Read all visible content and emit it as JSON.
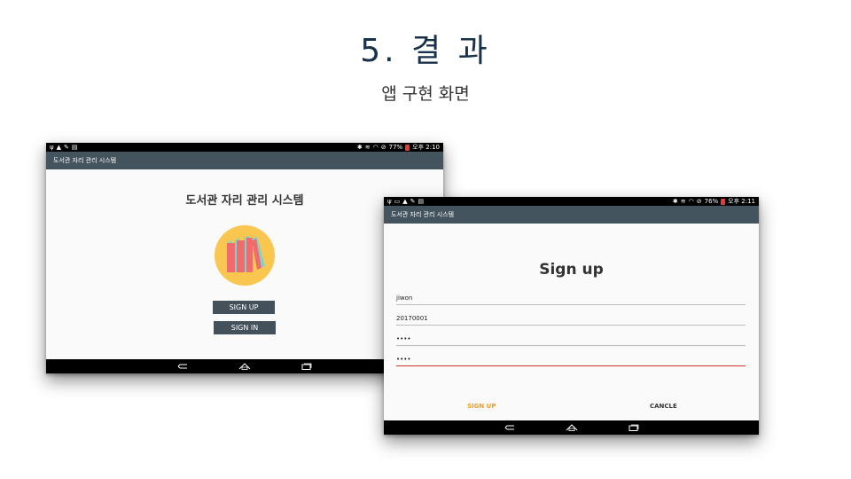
{
  "slide": {
    "title": "5. 결 과",
    "subtitle": "앱 구현 화면"
  },
  "tablet_main": {
    "status_time": "오후 2:10",
    "status_battery": "77%",
    "appbar_title": "도서관 자리 관리 시스템",
    "screen_title": "도서관 자리 관리 시스템",
    "logo_icon": "books-icon",
    "signup_label": "SIGN UP",
    "signin_label": "SIGN IN"
  },
  "tablet_signup": {
    "status_time": "오후 2:11",
    "status_battery": "76%",
    "appbar_title": "도서관 자리 관리 시스템",
    "screen_title": "Sign up",
    "fields": {
      "name": "jiwon",
      "student_id": "20170001",
      "password": "••••",
      "password_confirm": "••••"
    },
    "signup_label": "SIGN UP",
    "cancel_label": "CANCLE"
  },
  "colors": {
    "appbar": "#44545f",
    "accent_orange": "#f29b1a",
    "active_underline": "#d32f2f",
    "logo_circle": "#f9c74f"
  }
}
